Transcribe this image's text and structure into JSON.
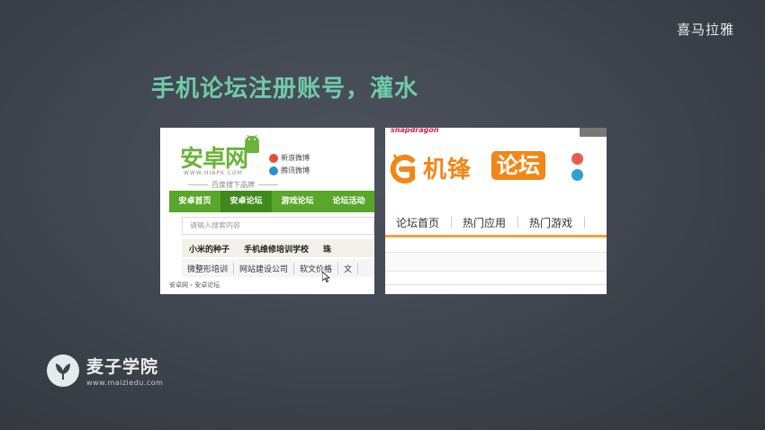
{
  "watermark_top_right": "喜马拉雅",
  "slide": {
    "title": "手机论坛注册账号，灌水"
  },
  "left_screenshot": {
    "logo_text": "安卓网",
    "logo_url": "WWW.HIAPK.COM",
    "slogan": "百度搜下品牌",
    "social": [
      "新浪微博",
      "腾讯微博"
    ],
    "nav": [
      "安卓首页",
      "安卓论坛",
      "游戏论坛",
      "论坛活动"
    ],
    "search_placeholder": "请输入搜索内容",
    "tags_row1": [
      "小米的种子",
      "手机维修培训学校",
      "珠"
    ],
    "tags_row2": [
      "微整形培训",
      "网站建设公司",
      "软文价格",
      "文"
    ],
    "breadcrumb": "安卓网 › 安卓论坛"
  },
  "right_screenshot": {
    "top_text": "snapdragon",
    "logo_text": "机锋",
    "logo_badge": "论坛",
    "nav": [
      "论坛首页",
      "热门应用",
      "热门游戏"
    ]
  },
  "brand": {
    "name": "麦子学院",
    "url": "www.maiziedu.com"
  },
  "colors": {
    "title_green": "#6fcba9",
    "android_green": "#58a72b",
    "gfan_orange": "#f18716"
  }
}
